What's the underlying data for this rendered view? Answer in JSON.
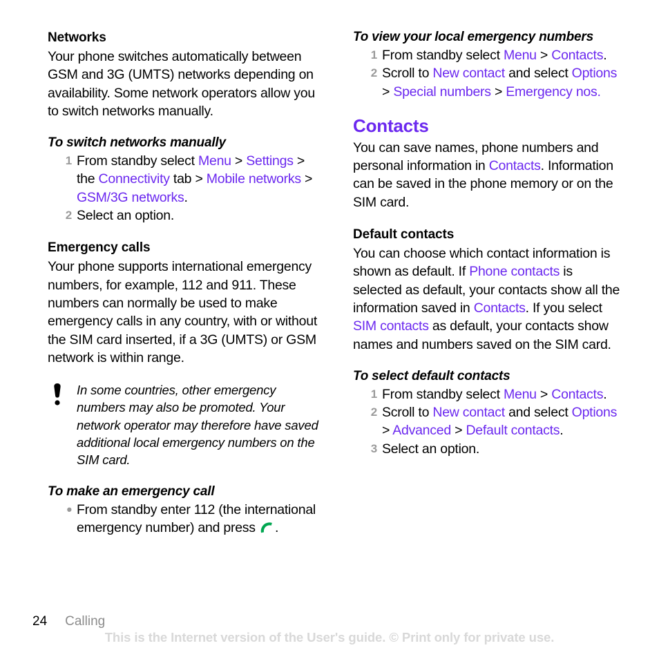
{
  "theme": {
    "link_color": "#6b28ef",
    "heading_color": "#6b28ef",
    "marker_color": "#9a9a9a",
    "text_color": "#000000",
    "watermark_color": "#d8d8d8",
    "call_icon_color": "#00a650",
    "chapter_color": "#8c8c8c"
  },
  "left_column": {
    "section_heading": "Networks",
    "intro_paragraph": "Your phone switches automatically between GSM and 3G (UMTS) networks depending on availability. Some network operators allow you to switch networks manually.",
    "task1": {
      "heading": "To switch networks manually",
      "steps": [
        {
          "marker": "1",
          "parts": [
            {
              "t": "From standby select ",
              "k": "plain"
            },
            {
              "t": "Menu",
              "k": "link"
            },
            {
              "t": " > ",
              "k": "plain"
            },
            {
              "t": "Settings",
              "k": "link"
            },
            {
              "t": " > the ",
              "k": "plain"
            },
            {
              "t": "Connectivity",
              "k": "link"
            },
            {
              "t": " tab > ",
              "k": "plain"
            },
            {
              "t": "Mobile networks",
              "k": "link"
            },
            {
              "t": " > ",
              "k": "plain"
            },
            {
              "t": "GSM/3G networks",
              "k": "link"
            },
            {
              "t": ".",
              "k": "plain"
            }
          ]
        },
        {
          "marker": "2",
          "parts": [
            {
              "t": "Select an option.",
              "k": "plain"
            }
          ]
        }
      ]
    },
    "subsection_heading": "Emergency calls",
    "subsection_paragraph": "Your phone supports international emergency numbers, for example, 112 and 911. These numbers can normally be used to make emergency calls in any country, with or without the SIM card inserted, if a 3G (UMTS) or GSM network is within range.",
    "note": {
      "icon": "exclamation-note-icon",
      "text": "In some countries, other emergency numbers may also be promoted. Your network operator may therefore have saved additional local emergency numbers on the SIM card."
    },
    "task2": {
      "heading": "To make an emergency call",
      "steps": [
        {
          "marker": "•",
          "parts": [
            {
              "t": "From standby enter 112 (the international emergency number) and press ",
              "k": "plain"
            },
            {
              "t": "",
              "k": "call-icon"
            },
            {
              "t": ".",
              "k": "plain"
            }
          ]
        }
      ]
    }
  },
  "right_column": {
    "task3": {
      "heading": "To view your local emergency numbers",
      "steps": [
        {
          "marker": "1",
          "parts": [
            {
              "t": "From standby select ",
              "k": "plain"
            },
            {
              "t": "Menu",
              "k": "link"
            },
            {
              "t": " > ",
              "k": "plain"
            },
            {
              "t": "Contacts",
              "k": "link"
            },
            {
              "t": ".",
              "k": "plain"
            }
          ]
        },
        {
          "marker": "2",
          "parts": [
            {
              "t": "Scroll to ",
              "k": "plain"
            },
            {
              "t": "New contact",
              "k": "link"
            },
            {
              "t": " and select ",
              "k": "plain"
            },
            {
              "t": "Options",
              "k": "link"
            },
            {
              "t": " > ",
              "k": "plain"
            },
            {
              "t": "Special numbers",
              "k": "link"
            },
            {
              "t": " > ",
              "k": "plain"
            },
            {
              "t": "Emergency nos.",
              "k": "link"
            }
          ]
        }
      ]
    },
    "chapter_heading": "Contacts",
    "chapter_paragraph_parts": [
      {
        "t": "You can save names, phone numbers and personal information in ",
        "k": "plain"
      },
      {
        "t": "Contacts",
        "k": "link"
      },
      {
        "t": ". Information can be saved in the phone memory or on the SIM card.",
        "k": "plain"
      }
    ],
    "subsection_heading": "Default contacts",
    "subsection_paragraph_parts": [
      {
        "t": "You can choose which contact information is shown as default. If ",
        "k": "plain"
      },
      {
        "t": "Phone contacts",
        "k": "link"
      },
      {
        "t": " is selected as default, your contacts show all the information saved in ",
        "k": "plain"
      },
      {
        "t": "Contacts",
        "k": "link"
      },
      {
        "t": ". If you select ",
        "k": "plain"
      },
      {
        "t": "SIM contacts",
        "k": "link"
      },
      {
        "t": " as default, your contacts show names and numbers saved on the SIM card.",
        "k": "plain"
      }
    ],
    "task4": {
      "heading": "To select default contacts",
      "steps": [
        {
          "marker": "1",
          "parts": [
            {
              "t": "From standby select ",
              "k": "plain"
            },
            {
              "t": "Menu",
              "k": "link"
            },
            {
              "t": " > ",
              "k": "plain"
            },
            {
              "t": "Contacts",
              "k": "link"
            },
            {
              "t": ".",
              "k": "plain"
            }
          ]
        },
        {
          "marker": "2",
          "parts": [
            {
              "t": "Scroll to ",
              "k": "plain"
            },
            {
              "t": "New contact",
              "k": "link"
            },
            {
              "t": " and select ",
              "k": "plain"
            },
            {
              "t": "Options",
              "k": "link"
            },
            {
              "t": " > ",
              "k": "plain"
            },
            {
              "t": "Advanced",
              "k": "link"
            },
            {
              "t": " > ",
              "k": "plain"
            },
            {
              "t": "Default contacts",
              "k": "link"
            },
            {
              "t": ".",
              "k": "plain"
            }
          ]
        },
        {
          "marker": "3",
          "parts": [
            {
              "t": "Select an option.",
              "k": "plain"
            }
          ]
        }
      ]
    }
  },
  "footer": {
    "page_number": "24",
    "chapter": "Calling",
    "watermark": "This is the Internet version of the User's guide. © Print only for private use."
  }
}
